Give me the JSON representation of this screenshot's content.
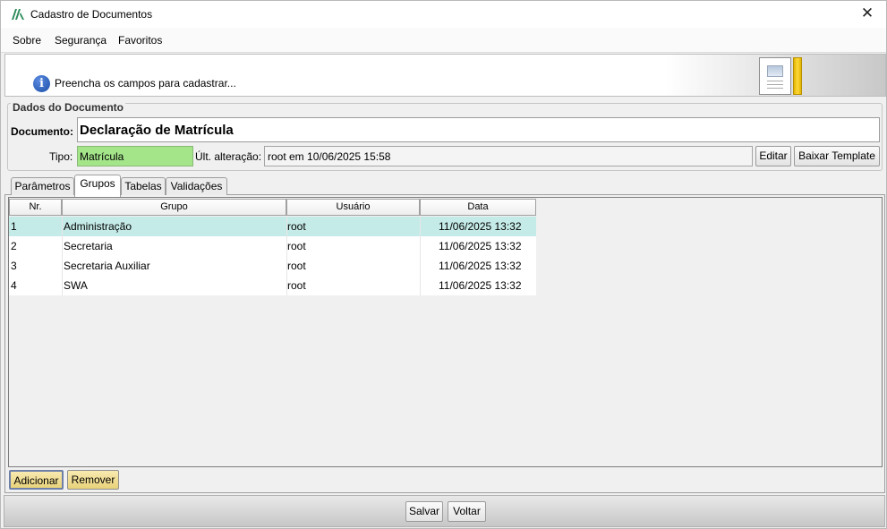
{
  "window": {
    "title": "Cadastro de Documentos",
    "close_icon": "close-icon",
    "app_icon": "app-logo-icon"
  },
  "menu": {
    "items": [
      "Sobre",
      "Segurança",
      "Favoritos"
    ]
  },
  "banner": {
    "message": "Preencha os campos para cadastrar...",
    "info_icon": "info-icon",
    "doc_icon": "document-thumbnail-icon"
  },
  "dados": {
    "legend": "Dados do Documento",
    "documento_label": "Documento:",
    "documento_value": "Declaração de Matrícula",
    "tipo_label": "Tipo:",
    "tipo_value": "Matrícula",
    "ult_alteracao_label": "Últ. alteração:",
    "ult_alteracao_value": "root em 10/06/2025 15:58",
    "editar_label": "Editar",
    "baixar_label": "Baixar Template"
  },
  "tabs": [
    {
      "label": "Parâmetros",
      "active": false
    },
    {
      "label": "Grupos",
      "active": true
    },
    {
      "label": "Tabelas",
      "active": false
    },
    {
      "label": "Validações",
      "active": false
    }
  ],
  "grid": {
    "columns": [
      "Nr.",
      "Grupo",
      "Usuário",
      "Data"
    ],
    "rows": [
      {
        "nr": "1",
        "grupo": "Administração",
        "usuario": "root",
        "data": "11/06/2025 13:32",
        "selected": true
      },
      {
        "nr": "2",
        "grupo": "Secretaria",
        "usuario": "root",
        "data": "11/06/2025 13:32",
        "selected": false
      },
      {
        "nr": "3",
        "grupo": "Secretaria Auxiliar",
        "usuario": "root",
        "data": "11/06/2025 13:32",
        "selected": false
      },
      {
        "nr": "4",
        "grupo": "SWA",
        "usuario": "root",
        "data": "11/06/2025 13:32",
        "selected": false
      }
    ]
  },
  "grid_buttons": {
    "adicionar": "Adicionar",
    "remover": "Remover"
  },
  "footer": {
    "salvar": "Salvar",
    "voltar": "Voltar"
  },
  "colors": {
    "selected_row": "#c5ebe8",
    "tipo_field": "#a4e58a",
    "adicionar_button": "#f2e29a"
  }
}
